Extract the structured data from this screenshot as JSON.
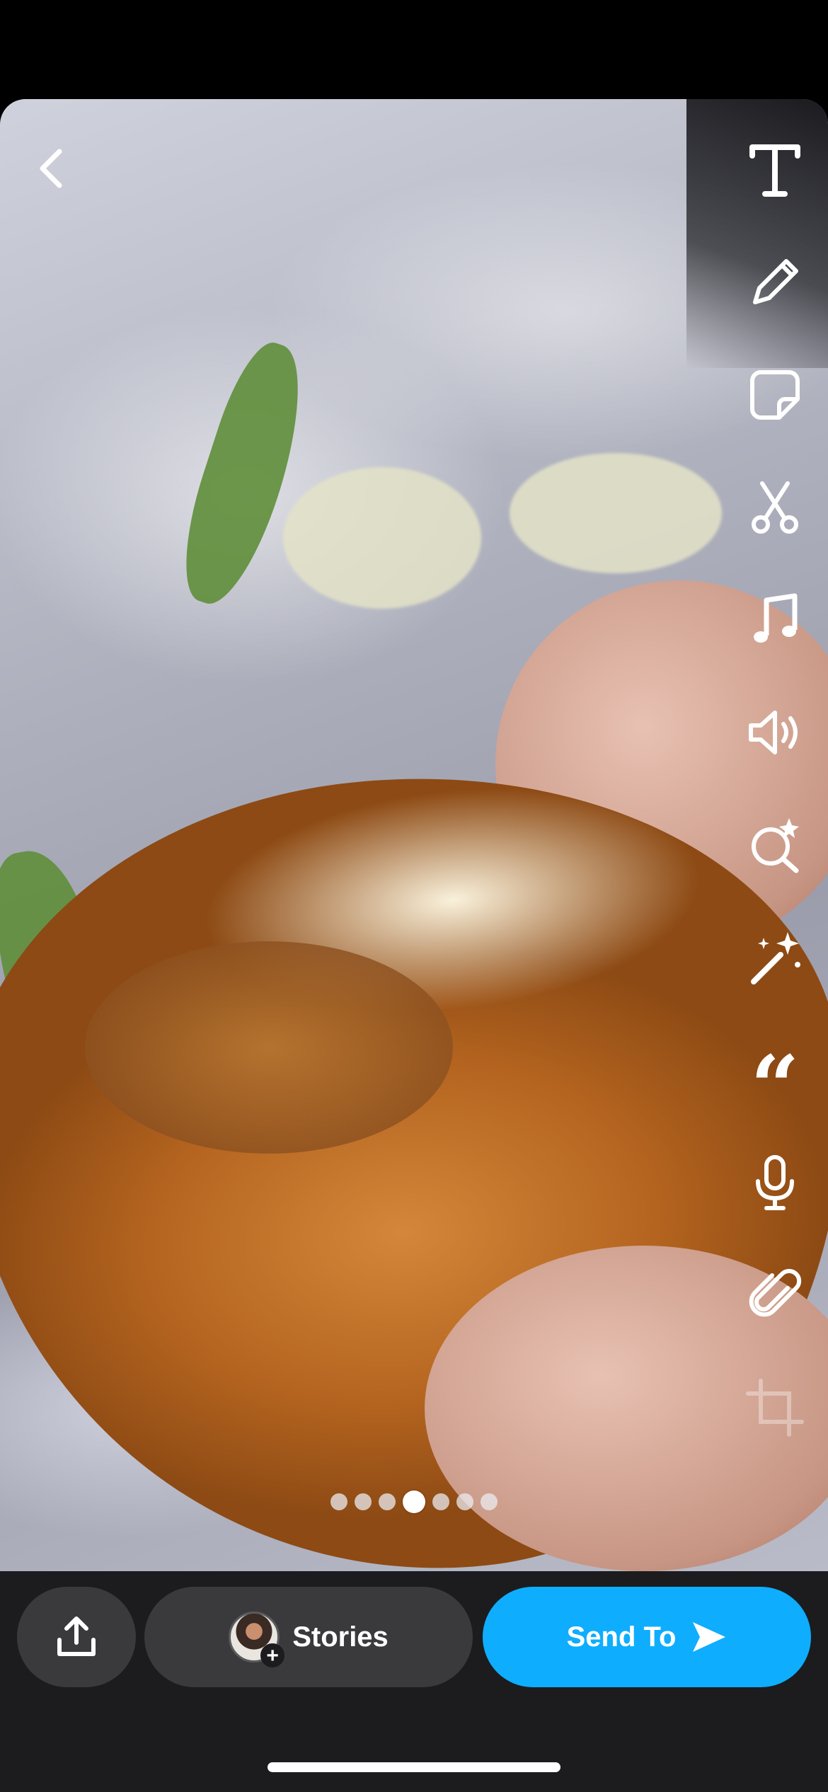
{
  "bottom_bar": {
    "stories_label": "Stories",
    "send_label": "Send To"
  },
  "pagination": {
    "total": 7,
    "active_index": 3
  },
  "tool_rail": {
    "icons": [
      "text-icon",
      "pencil-icon",
      "sticker-icon",
      "scissors-icon",
      "music-icon",
      "volume-icon",
      "lens-search-icon",
      "magic-wand-icon",
      "quote-icon",
      "microphone-icon",
      "paperclip-icon",
      "crop-icon"
    ]
  },
  "colors": {
    "send_button": "#0fadfe",
    "bottom_bar": "#1c1c1e",
    "pill_button": "#3a3a3c"
  }
}
